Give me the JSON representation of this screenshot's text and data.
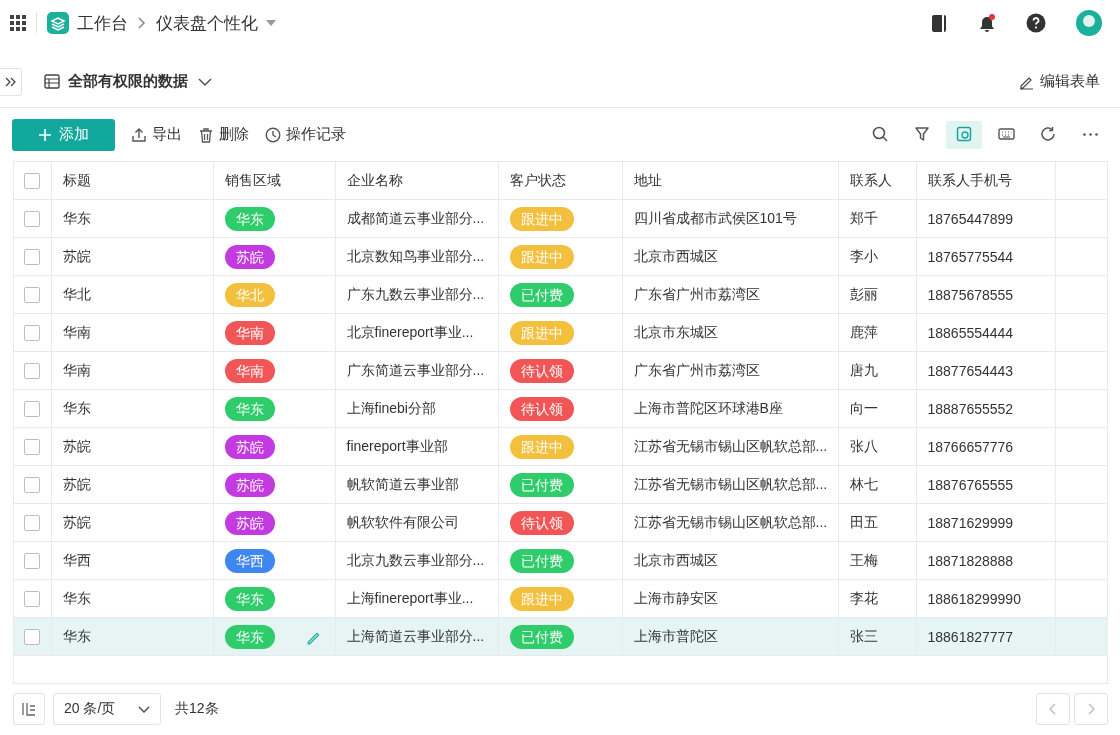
{
  "header": {
    "breadcrumb": [
      {
        "label": "工作台"
      },
      {
        "label": "仪表盘个性化"
      }
    ]
  },
  "view": {
    "title": "全部有权限的数据",
    "edit_label": "编辑表单"
  },
  "toolbar": {
    "add_label": "添加",
    "actions": [
      {
        "kind": "export",
        "label": "导出"
      },
      {
        "kind": "delete",
        "label": "删除"
      },
      {
        "kind": "history",
        "label": "操作记录"
      }
    ],
    "tools": [
      {
        "kind": "search",
        "selected": false
      },
      {
        "kind": "filter",
        "selected": false
      },
      {
        "kind": "card",
        "selected": true
      },
      {
        "kind": "keyboard",
        "selected": false
      },
      {
        "kind": "refresh",
        "selected": false
      },
      {
        "kind": "more",
        "selected": false
      }
    ]
  },
  "table": {
    "select_all_checked": false,
    "columns": [
      "标题",
      "销售区域",
      "企业名称",
      "客户状态",
      "地址",
      "联系人",
      "联系人手机号"
    ],
    "rows": [
      {
        "checked": false,
        "hovered": false,
        "title": "华东",
        "region": {
          "label": "华东",
          "color": "#2ecc6a"
        },
        "company": "成都简道云事业部分...",
        "status": {
          "label": "跟进中",
          "color": "#f3c03e"
        },
        "address": "四川省成都市武侯区101号",
        "contact": "郑千",
        "phone": "18765447899"
      },
      {
        "checked": false,
        "hovered": false,
        "title": "苏皖",
        "region": {
          "label": "苏皖",
          "color": "#c33ae0"
        },
        "company": "北京数知鸟事业部分...",
        "status": {
          "label": "跟进中",
          "color": "#f3c03e"
        },
        "address": "北京市西城区",
        "contact": "李小",
        "phone": "18765775544"
      },
      {
        "checked": false,
        "hovered": false,
        "title": "华北",
        "region": {
          "label": "华北",
          "color": "#f3c03e"
        },
        "company": "广东九数云事业部分...",
        "status": {
          "label": "已付费",
          "color": "#2ecc6a"
        },
        "address": "广东省广州市荔湾区",
        "contact": "彭丽",
        "phone": "18875678555"
      },
      {
        "checked": false,
        "hovered": false,
        "title": "华南",
        "region": {
          "label": "华南",
          "color": "#f25555"
        },
        "company": "北京finereport事业...",
        "status": {
          "label": "跟进中",
          "color": "#f3c03e"
        },
        "address": "北京市东城区",
        "contact": "鹿萍",
        "phone": "18865554444"
      },
      {
        "checked": false,
        "hovered": false,
        "title": "华南",
        "region": {
          "label": "华南",
          "color": "#f25555"
        },
        "company": "广东简道云事业部分...",
        "status": {
          "label": "待认领",
          "color": "#f25555"
        },
        "address": "广东省广州市荔湾区",
        "contact": "唐九",
        "phone": "18877654443"
      },
      {
        "checked": false,
        "hovered": false,
        "title": "华东",
        "region": {
          "label": "华东",
          "color": "#2ecc6a"
        },
        "company": "上海finebi分部",
        "status": {
          "label": "待认领",
          "color": "#f25555"
        },
        "address": "上海市普陀区环球港B座",
        "contact": "向一",
        "phone": "18887655552"
      },
      {
        "checked": false,
        "hovered": false,
        "title": "苏皖",
        "region": {
          "label": "苏皖",
          "color": "#c33ae0"
        },
        "company": "finereport事业部",
        "status": {
          "label": "跟进中",
          "color": "#f3c03e"
        },
        "address": "江苏省无锡市锡山区帆软总部...",
        "contact": "张八",
        "phone": "18766657776"
      },
      {
        "checked": false,
        "hovered": false,
        "title": "苏皖",
        "region": {
          "label": "苏皖",
          "color": "#c33ae0"
        },
        "company": "帆软简道云事业部",
        "status": {
          "label": "已付费",
          "color": "#2ecc6a"
        },
        "address": "江苏省无锡市锡山区帆软总部...",
        "contact": "林七",
        "phone": "18876765555"
      },
      {
        "checked": false,
        "hovered": false,
        "title": "苏皖",
        "region": {
          "label": "苏皖",
          "color": "#c33ae0"
        },
        "company": "帆软软件有限公司",
        "status": {
          "label": "待认领",
          "color": "#f25555"
        },
        "address": "江苏省无锡市锡山区帆软总部...",
        "contact": "田五",
        "phone": "18871629999"
      },
      {
        "checked": false,
        "hovered": false,
        "title": "华西",
        "region": {
          "label": "华西",
          "color": "#3e86f0"
        },
        "company": "北京九数云事业部分...",
        "status": {
          "label": "已付费",
          "color": "#2ecc6a"
        },
        "address": "北京市西城区",
        "contact": "王梅",
        "phone": "18871828888"
      },
      {
        "checked": false,
        "hovered": false,
        "title": "华东",
        "region": {
          "label": "华东",
          "color": "#2ecc6a"
        },
        "company": "上海finereport事业...",
        "status": {
          "label": "跟进中",
          "color": "#f3c03e"
        },
        "address": "上海市静安区",
        "contact": "李花",
        "phone": "188618299990"
      },
      {
        "checked": false,
        "hovered": true,
        "title": "华东",
        "region": {
          "label": "华东",
          "color": "#2ecc6a"
        },
        "company": "上海简道云事业部分...",
        "status": {
          "label": "已付费",
          "color": "#2ecc6a"
        },
        "address": "上海市普陀区",
        "contact": "张三",
        "phone": "18861827777"
      }
    ]
  },
  "pagination": {
    "page_size": "20 条/页",
    "total": "共12条"
  }
}
